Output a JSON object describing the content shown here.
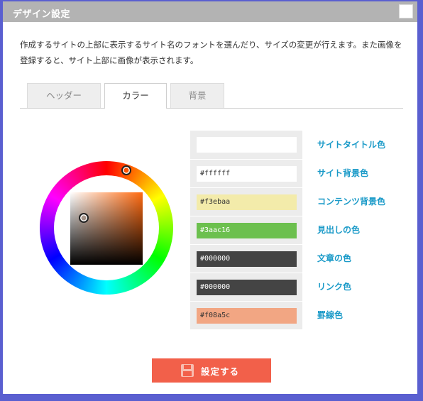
{
  "dialog": {
    "title": "デザイン設定",
    "description": "作成するサイトの上部に表示するサイト名のフォントを選んだり、サイズの変更が行えます。また画像を登録すると、サイト上部に画像が表示されます。"
  },
  "tabs": [
    {
      "label": "ヘッダー",
      "active": false
    },
    {
      "label": "カラー",
      "active": true
    },
    {
      "label": "背景",
      "active": false
    }
  ],
  "color_picker": {
    "hue_color": "#ff6a10"
  },
  "swatches": [
    {
      "value": "",
      "color": "#ffffff",
      "text_color": "#333333",
      "label": "サイトタイトル色"
    },
    {
      "value": "#ffffff",
      "color": "#ffffff",
      "text_color": "#333333",
      "label": "サイト背景色"
    },
    {
      "value": "#f3ebaa",
      "color": "#f3ebaa",
      "text_color": "#333333",
      "label": "コンテンツ背景色"
    },
    {
      "value": "#3aac16",
      "color": "#6cc04e",
      "text_color": "#ffffff",
      "label": "見出しの色"
    },
    {
      "value": "#000000",
      "color": "#444444",
      "text_color": "#ffffff",
      "label": "文章の色"
    },
    {
      "value": "#000000",
      "color": "#444444",
      "text_color": "#ffffff",
      "label": "リンク色"
    },
    {
      "value": "#f08a5c",
      "color": "#f2a683",
      "text_color": "#333333",
      "label": "罫線色"
    }
  ],
  "button": {
    "label": "設定する",
    "color": "#f2604a"
  }
}
